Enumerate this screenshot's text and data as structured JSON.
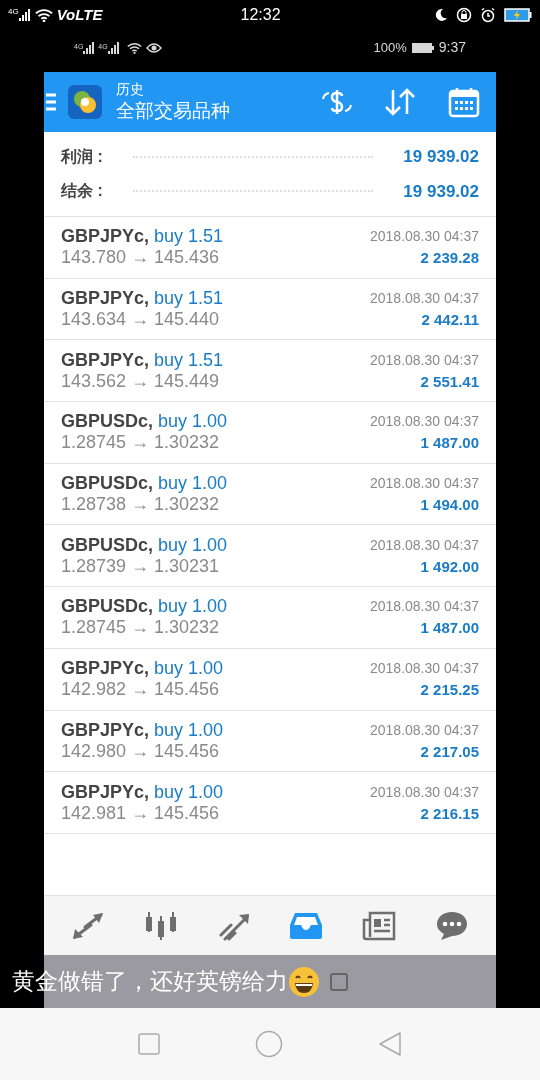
{
  "status_bar": {
    "network": "4G",
    "volte": "VoLTE",
    "time": "12:32"
  },
  "inner_status_bar": {
    "networks": [
      "4G",
      "4G"
    ],
    "battery": "100%",
    "time": "9:37"
  },
  "header": {
    "subtitle": "历史",
    "title": "全部交易品种"
  },
  "summary": [
    {
      "label": "利润 :",
      "value": "19 939.02"
    },
    {
      "label": "结余 :",
      "value": "19 939.02"
    }
  ],
  "trades": [
    {
      "symbol": "GBPJPYc,",
      "trade": "buy 1.51",
      "prices": "143.780 → 145.436",
      "time": "2018.08.30 04:37",
      "profit": "2 239.28"
    },
    {
      "symbol": "GBPJPYc,",
      "trade": "buy 1.51",
      "prices": "143.634 → 145.440",
      "time": "2018.08.30 04:37",
      "profit": "2 442.11"
    },
    {
      "symbol": "GBPJPYc,",
      "trade": "buy 1.51",
      "prices": "143.562 → 145.449",
      "time": "2018.08.30 04:37",
      "profit": "2 551.41"
    },
    {
      "symbol": "GBPUSDc,",
      "trade": "buy 1.00",
      "prices": "1.28745 → 1.30232",
      "time": "2018.08.30 04:37",
      "profit": "1 487.00"
    },
    {
      "symbol": "GBPUSDc,",
      "trade": "buy 1.00",
      "prices": "1.28738 → 1.30232",
      "time": "2018.08.30 04:37",
      "profit": "1 494.00"
    },
    {
      "symbol": "GBPUSDc,",
      "trade": "buy 1.00",
      "prices": "1.28739 → 1.30231",
      "time": "2018.08.30 04:37",
      "profit": "1 492.00"
    },
    {
      "symbol": "GBPUSDc,",
      "trade": "buy 1.00",
      "prices": "1.28745 → 1.30232",
      "time": "2018.08.30 04:37",
      "profit": "1 487.00"
    },
    {
      "symbol": "GBPJPYc,",
      "trade": "buy 1.00",
      "prices": "142.982 → 145.456",
      "time": "2018.08.30 04:37",
      "profit": "2 215.25"
    },
    {
      "symbol": "GBPJPYc,",
      "trade": "buy 1.00",
      "prices": "142.980 → 145.456",
      "time": "2018.08.30 04:37",
      "profit": "2 217.05"
    },
    {
      "symbol": "GBPJPYc,",
      "trade": "buy 1.00",
      "prices": "142.981 → 145.456",
      "time": "2018.08.30 04:37",
      "profit": "2 216.15"
    }
  ],
  "bottom_nav": [
    {
      "kind": "quotes",
      "selected": false
    },
    {
      "kind": "chart",
      "selected": false
    },
    {
      "kind": "trade",
      "selected": false
    },
    {
      "kind": "history",
      "selected": true
    },
    {
      "kind": "news",
      "selected": false
    },
    {
      "kind": "chat",
      "selected": false
    }
  ],
  "caption": {
    "text": "黄金做错了，还好英镑给力"
  }
}
